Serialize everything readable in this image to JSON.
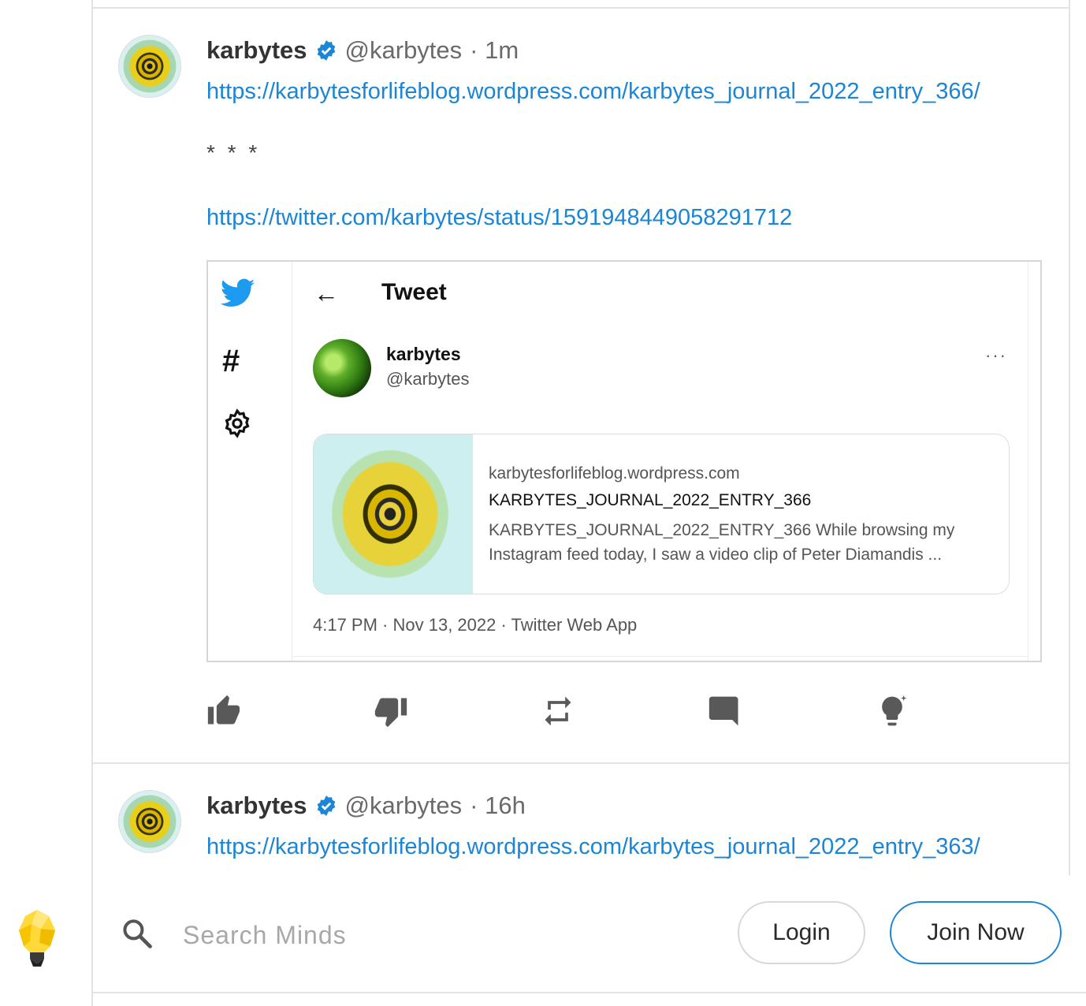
{
  "posts": [
    {
      "username": "karbytes",
      "handle": "@karbytes",
      "time": "· 1m",
      "link1": "https://karbytesforlifeblog.wordpress.com/karbytes_journal_2022_entry_366/",
      "separator": "* * *",
      "link2": "https://twitter.com/karbytes/status/1591948449058291712",
      "embed": {
        "header_title": "Tweet",
        "back_arrow": "←",
        "name": "karbytes",
        "handle": "@karbytes",
        "more": "···",
        "card": {
          "domain": "karbytesforlifeblog.wordpress.com",
          "title": "KARBYTES_JOURNAL_2022_ENTRY_366",
          "description": "KARBYTES_JOURNAL_2022_ENTRY_366 While browsing my Instagram feed today, I saw a video clip of Peter Diamandis ..."
        },
        "timestamp": "4:17 PM · Nov 13, 2022 · Twitter Web App"
      }
    },
    {
      "username": "karbytes",
      "handle": "@karbytes",
      "time": "· 16h",
      "link1": "https://karbytesforlifeblog.wordpress.com/karbytes_journal_2022_entry_363/"
    }
  ],
  "actions": [
    "thumbs-up-icon",
    "thumbs-down-icon",
    "remind-icon",
    "comment-icon",
    "boost-icon"
  ],
  "search": {
    "placeholder": "Search Minds"
  },
  "buttons": {
    "login": "Login",
    "join": "Join Now"
  },
  "colors": {
    "link": "#1b85d6",
    "verified": "#1b85d6",
    "twitter_blue": "#1d9bf0",
    "icon_gray": "#595959"
  }
}
